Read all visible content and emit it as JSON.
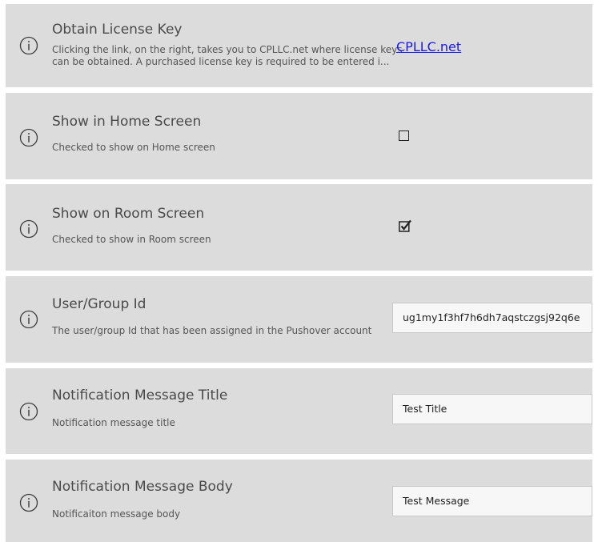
{
  "settings": [
    {
      "title": "Obtain License Key",
      "desc_line1": "Clicking the link, on the right, takes you to CPLLC.net where license keys",
      "desc_line2": "can be obtained.  A purchased license key is required to be entered i...",
      "link": "CPLLC.net"
    },
    {
      "title": "Show in Home Screen",
      "desc": "Checked to show on Home screen",
      "checked": false
    },
    {
      "title": "Show on Room Screen",
      "desc": "Checked to show in Room screen",
      "checked": true
    },
    {
      "title": "User/Group Id",
      "desc": "The user/group Id that has been assigned in the Pushover account",
      "value": "ug1my1f3hf7h6dh7aqstczgsj92q6e"
    },
    {
      "title": "Notification Message Title",
      "desc": "Notification message title",
      "value": "Test Title"
    },
    {
      "title": "Notification Message Body",
      "desc": "Notificaiton message body",
      "value": "Test Message"
    }
  ],
  "icons": {
    "row_icon": "info-icon"
  },
  "colors": {
    "row_bg": "#dcdcdc",
    "link": "#1a1aee",
    "input_bg": "#f7f7f7"
  }
}
